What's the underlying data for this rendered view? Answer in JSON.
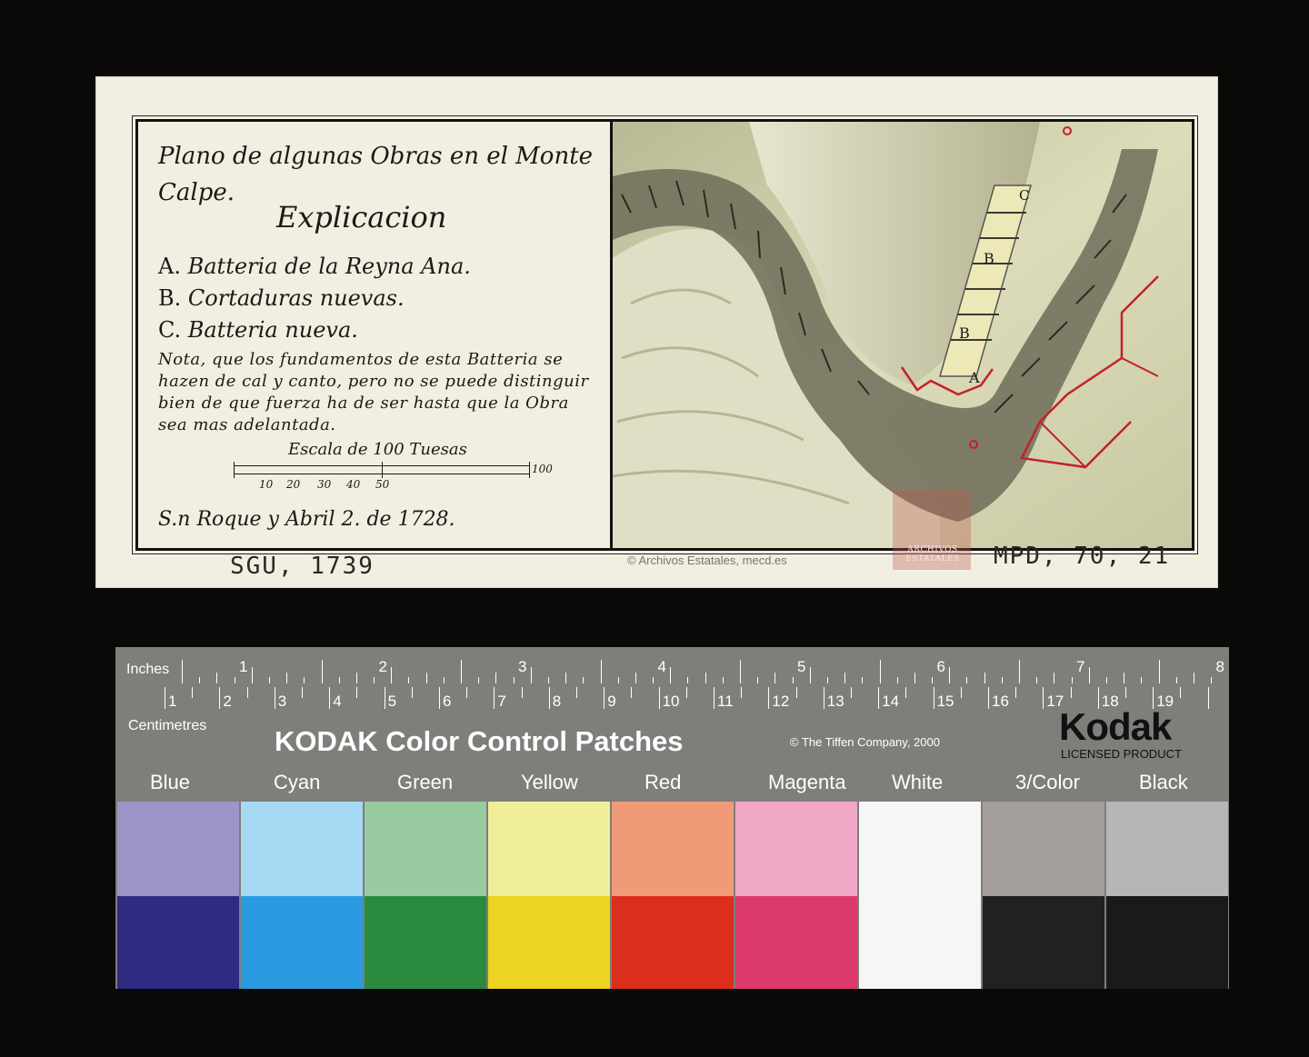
{
  "map_sheet": {
    "title": "Plano de algunas Obras en el Monte Calpe.",
    "heading": "Explicacion",
    "legend": [
      {
        "letter": "A.",
        "text": "Batteria de la Reyna Ana."
      },
      {
        "letter": "B.",
        "text": "Cortaduras nuevas."
      },
      {
        "letter": "C.",
        "text": "Batteria nueva."
      }
    ],
    "note": "Nota, que los fundamentos de esta Batteria se hazen de cal y canto, pero no se puede distinguir bien de que fuerza ha de ser hasta que la Obra sea mas adelantada.",
    "scale": {
      "title": "Escala de 100 Tuesas",
      "ticks": [
        "10",
        "20",
        "30",
        "40",
        "50"
      ],
      "end": "100"
    },
    "date": "S.n Roque y Abril 2. de 1728.",
    "map_letters": [
      "A",
      "B",
      "B",
      "C"
    ],
    "ref_left": "SGU, 1739",
    "ref_right": "MPD, 70, 21",
    "copyright": "© Archivos Estatales, mecd.es",
    "stamp": "ARCHIVOS ESTATALES",
    "colors": {
      "paper": "#f1efe1",
      "rock_light": "#cfcfa8",
      "rock_dark": "#6b6a55",
      "wall_red": "#c4202a",
      "ink": "#1b1a16"
    }
  },
  "kodak_target": {
    "inches_label": "Inches",
    "centimetres_label": "Centimetres",
    "inch_numbers": [
      "1",
      "2",
      "3",
      "4",
      "5",
      "6",
      "7",
      "8"
    ],
    "cm_numbers": [
      "1",
      "2",
      "3",
      "4",
      "5",
      "6",
      "7",
      "8",
      "9",
      "10",
      "11",
      "12",
      "13",
      "14",
      "15",
      "16",
      "17",
      "18",
      "19"
    ],
    "title": "KODAK Color Control Patches",
    "copyright": "© The Tiffen Company, 2000",
    "logo": "Kodak",
    "licensed": "LICENSED PRODUCT",
    "patches": [
      {
        "label": "Blue",
        "top": "#9c95c8",
        "bottom": "#2f2b82"
      },
      {
        "label": "Cyan",
        "top": "#a5d8f2",
        "bottom": "#2a9be0"
      },
      {
        "label": "Green",
        "top": "#98cca0",
        "bottom": "#2a8a40"
      },
      {
        "label": "Yellow",
        "top": "#f1ee9a",
        "bottom": "#eed422"
      },
      {
        "label": "Red",
        "top": "#f09a78",
        "bottom": "#dc2e1c"
      },
      {
        "label": "Magenta",
        "top": "#f0a8c6",
        "bottom": "#db3a6a"
      },
      {
        "label": "White",
        "top": "#f6f6f6",
        "bottom": "#f6f6f6"
      },
      {
        "label": "3/Color",
        "top": "#a39d9c",
        "bottom": "#222023"
      },
      {
        "label": "Black",
        "top": "#b6b6b6",
        "bottom": "#1a1a1a"
      }
    ]
  }
}
